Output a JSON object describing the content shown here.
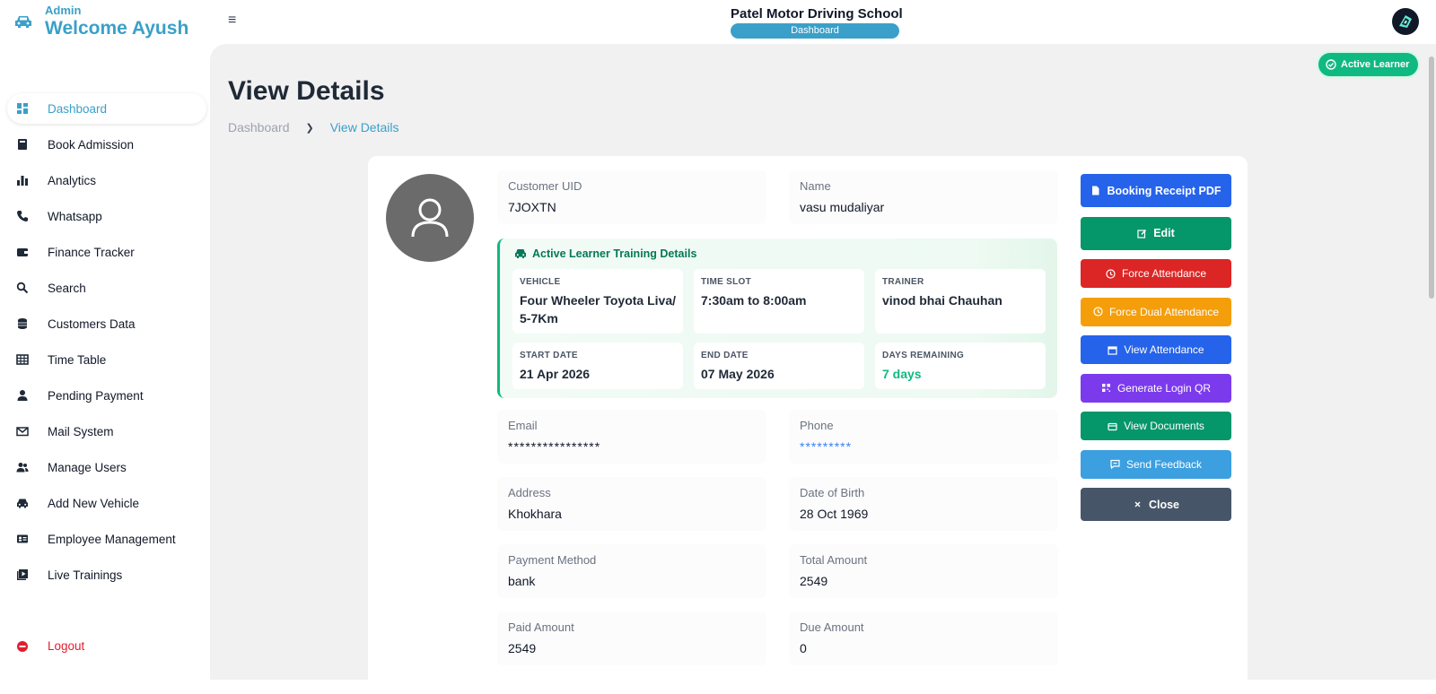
{
  "sidebar": {
    "role": "Admin",
    "welcome": "Welcome Ayush",
    "items": [
      {
        "label": "Dashboard"
      },
      {
        "label": "Book Admission"
      },
      {
        "label": "Analytics"
      },
      {
        "label": "Whatsapp"
      },
      {
        "label": "Finance Tracker"
      },
      {
        "label": "Search"
      },
      {
        "label": "Customers Data"
      },
      {
        "label": "Time Table"
      },
      {
        "label": "Pending Payment"
      },
      {
        "label": "Mail System"
      },
      {
        "label": "Manage Users"
      },
      {
        "label": "Add New Vehicle"
      },
      {
        "label": "Employee Management"
      },
      {
        "label": "Live Trainings"
      }
    ],
    "logout": "Logout"
  },
  "header": {
    "school": "Patel Motor Driving School",
    "section": "Dashboard"
  },
  "page": {
    "title": "View Details",
    "breadcrumb": [
      "Dashboard",
      "View Details"
    ],
    "status_badge": "Active Learner"
  },
  "customer": {
    "uid_label": "Customer UID",
    "uid": "7JOXTN",
    "name_label": "Name",
    "name": "vasu mudaliyar",
    "email_label": "Email",
    "email": "****************",
    "phone_label": "Phone",
    "phone": "*********",
    "address_label": "Address",
    "address": "Khokhara",
    "dob_label": "Date of Birth",
    "dob": "28 Oct 1969",
    "payment_label": "Payment Method",
    "payment": "bank",
    "total_label": "Total Amount",
    "total": "2549",
    "paid_label": "Paid Amount",
    "paid": "2549",
    "due_label": "Due Amount",
    "due": "0"
  },
  "training": {
    "heading": "Active Learner Training Details",
    "vehicle_label": "VEHICLE",
    "vehicle": "Four Wheeler Toyota Liva/ 5-7Km",
    "slot_label": "TIME SLOT",
    "slot": "7:30am to 8:00am",
    "trainer_label": "TRAINER",
    "trainer": "vinod bhai Chauhan",
    "start_label": "START DATE",
    "start": "21 Apr 2026",
    "end_label": "END DATE",
    "end": "07 May 2026",
    "remaining_label": "DAYS REMAINING",
    "remaining": "7 days"
  },
  "actions": {
    "receipt": "Booking Receipt PDF",
    "edit": "Edit",
    "force": "Force Attendance",
    "force_dual": "Force Dual Attendance",
    "view_att": "View Attendance",
    "qr": "Generate Login QR",
    "docs": "View Documents",
    "feedback": "Send Feedback",
    "close": "Close"
  },
  "colors": {
    "accent": "#3aa0c9",
    "success": "#10b981",
    "danger": "#dc2626",
    "warning": "#f59e0b",
    "purple": "#7c3aed"
  }
}
